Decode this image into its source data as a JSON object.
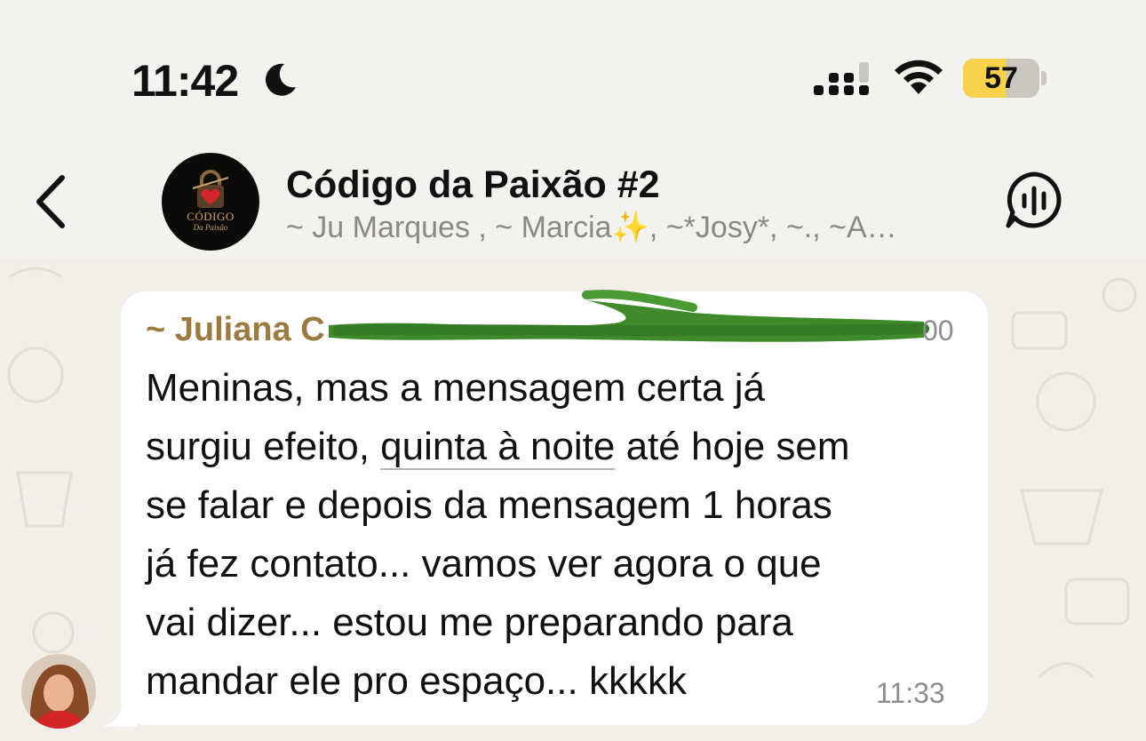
{
  "status_bar": {
    "time": "11:42",
    "battery_level": "57",
    "battery_fraction": 0.57
  },
  "header": {
    "back_icon": "chevron-left-icon",
    "group_avatar": {
      "logo_line1": "CÓDIGO",
      "logo_line2": "Da Paixão"
    },
    "title": "Código da Paixão #2",
    "members": "~ Ju Marques , ~ Marcia✨, ~*Josy*, ~., ~A…",
    "voice_icon": "voice-chat-icon"
  },
  "message": {
    "sender": "~ Juliana C",
    "sender_suffix": "00",
    "lines": [
      "Meninas, mas a mensagem certa já",
      "surgiu efeito, ",
      "se falar e depois da mensagem 1 horas",
      "já fez contato... vamos ver agora o que",
      "vai dizer... estou me preparando para",
      "mandar ele pro espaço... kkkkk"
    ],
    "line2_link": "quinta à noite",
    "line2_rest": " até hoje sem",
    "time": "11:33"
  },
  "colors": {
    "sender_name": "#9b7b3f",
    "battery_fill": "#f7d24a",
    "scribble": "#3f8a2b",
    "bubble": "#ffffff",
    "wallpaper": "#f2efe8"
  }
}
